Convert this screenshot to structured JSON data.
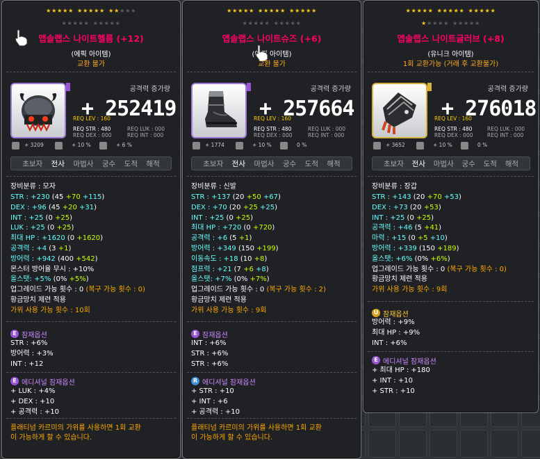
{
  "tooltips": [
    {
      "stars_on": 12,
      "stars_total": 15,
      "row2_on": 0,
      "row2_total": 10,
      "title": "앱솔랩스 나이트헬름 (+12)",
      "grade_label": "(에픽 아이템)",
      "trade": "교환 불가",
      "stat_label": "공격력 증가량",
      "plus": "+",
      "power": "252419",
      "req_lev": "REQ LEV : 160",
      "req_str": "REQ STR : 480",
      "req_dex": "REQ DEX : 000",
      "req_luk": "REQ LUK : 000",
      "req_int": "REQ INT : 000",
      "mini_a": "+ 3209",
      "mini_b": "+ 10 %",
      "mini_c": "+ 6 %",
      "jobs": [
        "초보자",
        "전사",
        "마법사",
        "궁수",
        "도적",
        "해적"
      ],
      "current_job": "전사",
      "category": "장비분류 : 모자",
      "lines": [
        {
          "k": "STR : ",
          "v": "+230",
          "paren": "(45 ",
          "add1": "+70",
          "add2": " +115",
          ")": ")"
        },
        {
          "k": "DEX : ",
          "v": "+96",
          "paren": "(45 ",
          "add1": "+20",
          "add2": " +31",
          ")": ")"
        },
        {
          "k": "INT : ",
          "v": "+25",
          "paren": "(0 ",
          "add1": "+25",
          "add2": "",
          ")": ")"
        },
        {
          "k": "LUK : ",
          "v": "+25",
          "paren": "(0 ",
          "add1": "+25",
          "add2": "",
          ")": ")"
        },
        {
          "k": "최대 HP : ",
          "v": "+1620",
          "paren": "(0 ",
          "add1": "+1620",
          "add2": "",
          ")": ")"
        },
        {
          "k": "공격력 : ",
          "v": "+4",
          "paren": "(3 ",
          "add1": "+1",
          "add2": "",
          ")": ")"
        },
        {
          "k": "방어력 : ",
          "v": "+942",
          "paren": "(400 ",
          "add1": "+542",
          "add2": "",
          ")": ")"
        }
      ],
      "extra_lines": [
        "몬스터 방어율 무시 : +10%"
      ],
      "allstat": {
        "k": "올스탯: ",
        "v": "+5%",
        "paren": "(0% ",
        "add1": "+5%",
        ")": ")"
      },
      "upgrade": "업그레이드 가능 횟수 : 0",
      "restore": "(복구 가능 횟수 : 0)",
      "hammer": "황금망치 제련 적용",
      "scissors": "가위 사용 가능 횟수 : 10회",
      "pot_title": "잠재옵션",
      "pot_lines": [
        "STR : +6%",
        "방어력 : +3%",
        "INT : +12"
      ],
      "add_title": "에디셔널 잠재옵션",
      "add_lines": [
        "+ LUK : +4%",
        "+ DEX : +10",
        "+ 공격력 : +10"
      ],
      "footer": [
        "플래티넘 카르미의 가위를 사용하면 1회 교환",
        "이 가능하게 할 수 있습니다."
      ]
    },
    {
      "stars_on": 15,
      "stars_total": 15,
      "title": "앱솔랩스 나이트슈즈 (+6)",
      "grade_label": "(에픽 아이템)",
      "trade": "교환 불가",
      "stat_label": "공격력 증가량",
      "plus": "+",
      "power": "257664",
      "req_lev": "REQ LEV : 160",
      "req_str": "REQ STR : 480",
      "req_dex": "REQ DEX : 000",
      "req_luk": "REQ LUK : 000",
      "req_int": "REQ INT : 000",
      "mini_a": "+ 1774",
      "mini_b": "+ 10 %",
      "mini_c": "0 %",
      "jobs": [
        "초보자",
        "전사",
        "마법사",
        "궁수",
        "도적",
        "해적"
      ],
      "category": "장비분류 : 신발",
      "lines": [
        {
          "k": "STR : ",
          "v": "+137",
          "paren": "(20 ",
          "add1": "+50",
          "add2": " +67"
        },
        {
          "k": "DEX : ",
          "v": "+70",
          "paren": "(20 ",
          "add1": "+25",
          "add2": " +25"
        },
        {
          "k": "INT : ",
          "v": "+25",
          "paren": "(0 ",
          "add1": "+25",
          "add2": ""
        },
        {
          "k": "최대 HP : ",
          "v": "+720",
          "paren": "(0 ",
          "add1": "+720",
          "add2": ""
        },
        {
          "k": "공격력 : ",
          "v": "+6",
          "paren": "(5 ",
          "add1": "+1",
          "add2": ""
        },
        {
          "k": "방어력 : ",
          "v": "+349",
          "paren": "(150 ",
          "add1": "+199",
          "add2": ""
        },
        {
          "k": "이동속도 : ",
          "v": "+18",
          "paren": "(10 ",
          "add1": "+8",
          "add2": ""
        },
        {
          "k": "점프력 : ",
          "v": "+21",
          "paren": "(7 ",
          "add1": "+6",
          "add2": " +8"
        }
      ],
      "allstat": {
        "k": "올스탯: ",
        "v": "+7%",
        "paren": "(0% ",
        "add1": "+7%"
      },
      "upgrade": "업그레이드 가능 횟수 : 0",
      "restore": "(복구 가능 횟수 : 2)",
      "hammer": "황금망치 제련 적용",
      "scissors": "가위 사용 가능 횟수 : 9회",
      "pot_title": "잠재옵션",
      "pot_lines": [
        "INT : +6%",
        "STR : +6%",
        "STR : +6%"
      ],
      "add_title": "에디셔널 잠재옵션",
      "add_lines": [
        "+ STR : +10",
        "+ INT : +6",
        "+ 공격력 : +10"
      ],
      "footer": [
        "플래티넘 카르미의 가위를 사용하면 1회 교환",
        "이 가능하게 할 수 있습니다."
      ]
    },
    {
      "stars_on": 16,
      "stars_total": 25,
      "title": "앱솔랩스 나이트글러브 (+8)",
      "grade_label": "(유니크 아이템)",
      "trade": "1회 교환가능 (거래 후 교환불가)",
      "stat_label": "공격력 증가량",
      "plus": "+",
      "power": "276018",
      "req_lev": "REQ LEV : 160",
      "req_str": "REQ STR : 480",
      "req_dex": "REQ DEX : 000",
      "req_luk": "REQ LUK : 000",
      "req_int": "REQ INT : 000",
      "mini_a": "+ 3652",
      "mini_b": "+ 10 %",
      "mini_c": "0 %",
      "jobs": [
        "초보자",
        "전사",
        "마법사",
        "궁수",
        "도적",
        "해적"
      ],
      "category": "장비분류 : 장갑",
      "lines": [
        {
          "k": "STR : ",
          "v": "+143",
          "paren": "(20 ",
          "add1": "+70",
          "add2": " +53"
        },
        {
          "k": "DEX : ",
          "v": "+73",
          "paren": "(20 ",
          "add1": "+53",
          "add2": ""
        },
        {
          "k": "INT : ",
          "v": "+25",
          "paren": "(0 ",
          "add1": "+25",
          "add2": ""
        },
        {
          "k": "공격력 : ",
          "v": "+46",
          "paren": "(5 ",
          "add1": "+41",
          "add2": ""
        },
        {
          "k": "마력 : ",
          "v": "+15",
          "paren": "(0 ",
          "add1": "+5",
          "add2": " +10"
        },
        {
          "k": "방어력 : ",
          "v": "+339",
          "paren": "(150 ",
          "add1": "+189",
          "add2": ""
        }
      ],
      "allstat": {
        "k": "올스탯: ",
        "v": "+6%",
        "paren": "(0% ",
        "add1": "+6%"
      },
      "upgrade": "업그레이드 가능 횟수 : 0",
      "restore": "(복구 가능 횟수 : 0)",
      "hammer": "황금망치 제련 적용",
      "scissors": "가위 사용 가능 횟수 : 9회",
      "pot_title": "잠재옵션",
      "pot_lines": [
        "방어력 : +9%",
        "최대 HP : +9%",
        "INT : +6%"
      ],
      "add_title": "에디셔널 잠재옵션",
      "add_lines": [
        "+ 최대 HP : +180",
        "+ INT : +10",
        "+ STR : +10"
      ]
    }
  ],
  "icons": {
    "helm": "helm-icon",
    "shoes": "shoes-icon",
    "gloves": "gloves-icon",
    "cursor": "hand-cursor-icon"
  },
  "colors": {
    "title": "#ff0066",
    "stat_white": "#ffffff",
    "stat_cyan": "#66ffff",
    "stat_green": "#ccff00",
    "orange": "#ffaa00",
    "epic": "#9954d8",
    "rare": "#3d8fd8",
    "unique": "#d9a11b"
  }
}
